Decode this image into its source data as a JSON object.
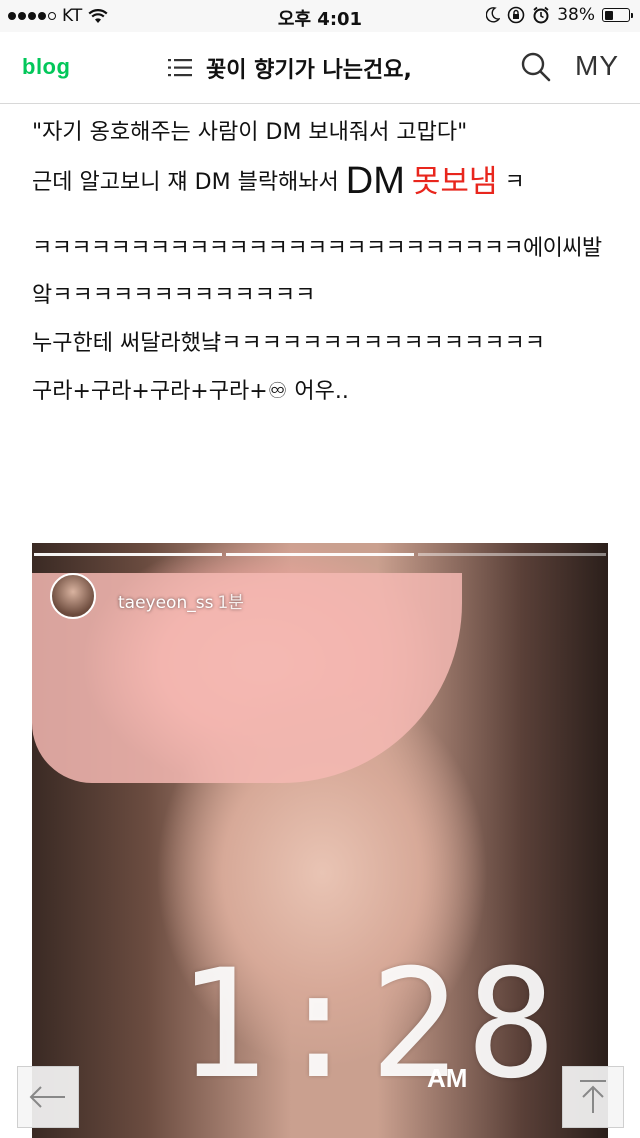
{
  "status_bar": {
    "carrier": "KT",
    "time": "오후 4:01",
    "battery_text": "38%",
    "battery_level": 0.38
  },
  "header": {
    "logo": "blog",
    "title": "꽃이 향기가 나는건요,",
    "my_label": "MY"
  },
  "post": {
    "line1": "\"자기 옹호해주는 사람이 DM 보내줘서 고맙다\"",
    "line2_prefix": "근데 알고보니 쟤 DM 블락해놔서 ",
    "line2_dm": "DM",
    "line2_red": "못보냄",
    "line2_suffix": "ㅋ",
    "line3": "ㅋㅋㅋㅋㅋㅋㅋㅋㅋㅋㅋㅋㅋㅋㅋㅋㅋㅋㅋㅋㅋㅋㅋㅋㅋ에이씨발",
    "line4": "앜ㅋㅋㅋㅋㅋㅋㅋㅋㅋㅋㅋㅋㅋ",
    "line5": "누구한테 써달라했냨ㅋㅋㅋㅋㅋㅋㅋㅋㅋㅋㅋㅋㅋㅋㅋㅋ",
    "line6": "구라+구라+구라+구라+♾ 어우.."
  },
  "story": {
    "username": "taeyeon_ss",
    "time_ago": "1분",
    "clock": "1:28",
    "ampm": "AM"
  },
  "nav": {
    "back_icon": "arrow-left-icon",
    "top_icon": "arrow-up-icon"
  },
  "colors": {
    "brand": "#03c75a",
    "highlight": "#e8261d"
  }
}
